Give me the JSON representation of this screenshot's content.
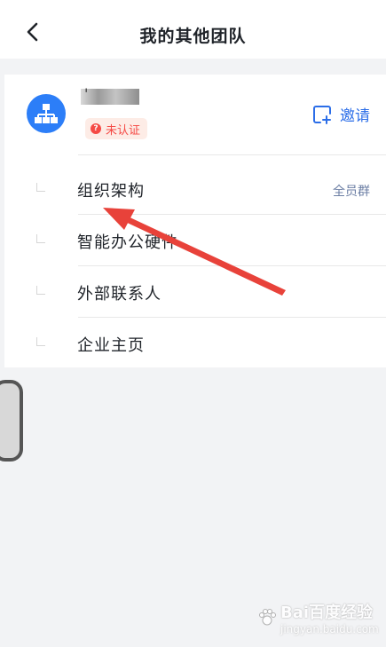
{
  "header": {
    "title": "我的其他团队",
    "back_icon": "chevron-left-icon"
  },
  "team": {
    "avatar_icon": "org-chart-icon",
    "name_mark": "'",
    "badge_icon": "question-circle-icon",
    "badge_text": "未认证",
    "badge_color": "#f54a45",
    "invite_icon": "add-member-icon",
    "invite_label": "邀请"
  },
  "menu": {
    "items": [
      {
        "label": "组织架构",
        "extra": "全员群"
      },
      {
        "label": "智能办公硬件",
        "extra": ""
      },
      {
        "label": "外部联系人",
        "extra": ""
      },
      {
        "label": "企业主页",
        "extra": ""
      }
    ]
  },
  "colors": {
    "accent": "#2c7ef8",
    "annotation_arrow": "#e8423a"
  },
  "watermark": {
    "text": "Bai百度经验",
    "sub": "jingyan.baidu.com"
  }
}
